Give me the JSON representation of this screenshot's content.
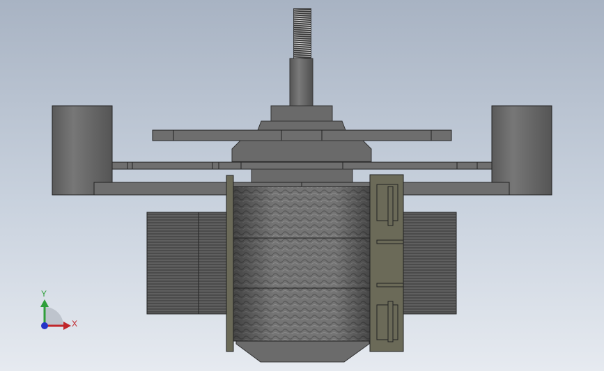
{
  "viewport": {
    "view_name": "front-view",
    "background_top": "#a8b3c3",
    "background_bottom": "#e6eaf0"
  },
  "triad": {
    "x_label": "X",
    "y_label": "Y",
    "x_color": "#c0262a",
    "y_color": "#2f9e3a",
    "z_color": "#2434c8"
  },
  "model": {
    "parts": [
      "threaded-shaft",
      "spindle",
      "upper-flange-plate",
      "lower-flange-plate",
      "base-plate",
      "left-cylinder",
      "right-cylinder",
      "winding-coil",
      "left-lamination-stack",
      "right-lamination-stack",
      "terminal-bracket",
      "bottom-housing"
    ],
    "body_color": "#6d6d6d",
    "coil_color": "#7a7a7a",
    "bracket_color": "#6b6a58"
  }
}
